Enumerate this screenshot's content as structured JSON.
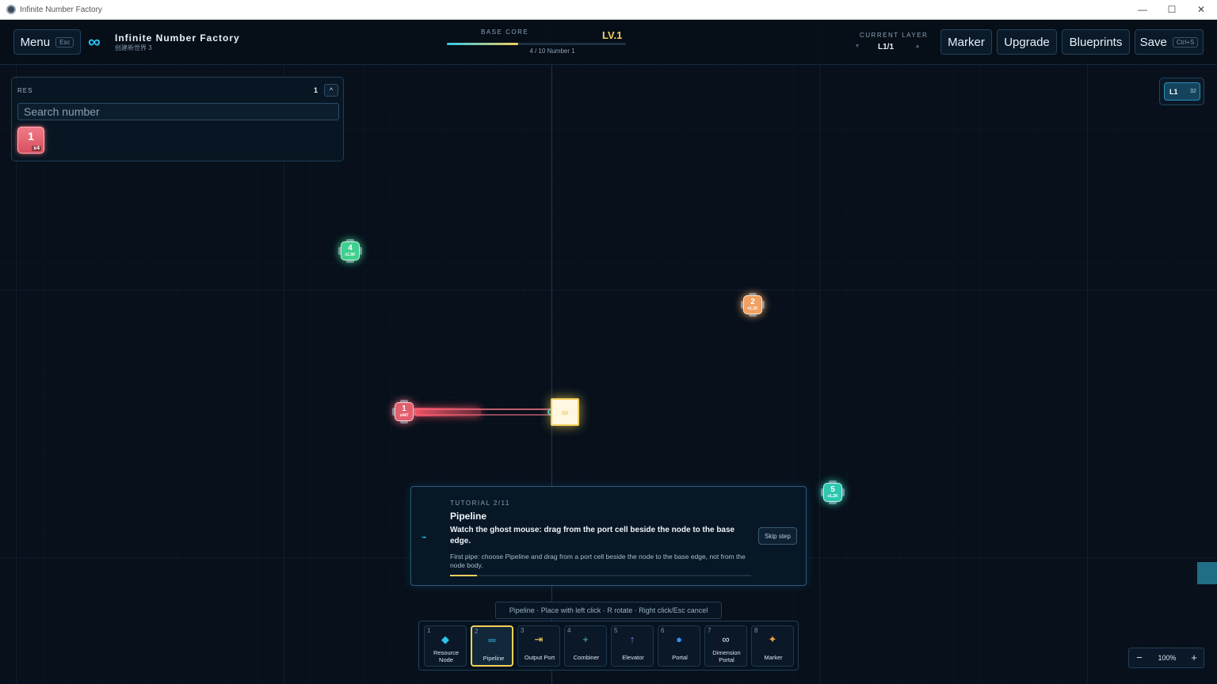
{
  "window": {
    "title": "Infinite Number Factory",
    "controls": {
      "minimize": "—",
      "maximize": "☐",
      "close": "✕"
    }
  },
  "header": {
    "menu_label": "Menu",
    "menu_key": "Esc",
    "logo_icon": "infinity-icon",
    "logo_glyph": "∞",
    "game_title": "Infinite Number Factory",
    "world_name": "创建新世界 3",
    "base_core": {
      "label": "BASE CORE",
      "level": "LV.1",
      "progress_text": "4 / 10 Number 1",
      "progress_fraction": 0.4
    },
    "current_layer": {
      "label": "CURRENT LAYER",
      "value": "L1/1",
      "down_arrow": "▼",
      "up_arrow": "▲"
    },
    "buttons": {
      "marker": "Marker",
      "upgrade": "Upgrade",
      "blueprints": "Blueprints",
      "save": "Save",
      "save_key": "Ctrl+S"
    }
  },
  "resources": {
    "title": "RES",
    "count": "1",
    "collapse_glyph": "^",
    "search_placeholder": "Search number",
    "items": [
      {
        "number": "1",
        "qty": "x4",
        "color": "#e0606e"
      }
    ]
  },
  "layer_badge": {
    "layer": "L1",
    "count": "32"
  },
  "map": {
    "nodes": [
      {
        "number": "4",
        "qty": "x1.5K",
        "color": "#3fcf8e"
      },
      {
        "number": "2",
        "qty": "x1.1K",
        "color": "#f0a060"
      },
      {
        "number": "1",
        "qty": "x447",
        "color": "#e0606e"
      },
      {
        "number": "5",
        "qty": "x1.2K",
        "color": "#2fc7b0"
      }
    ],
    "base_symbol": "∞"
  },
  "tutorial": {
    "icon_glyph": "⌁",
    "step": "TUTORIAL 2/11",
    "title": "Pipeline",
    "instruction": "Watch the ghost mouse: drag from the port cell beside the node to the base edge.",
    "description": "First pipe: choose Pipeline and drag from a port cell beside the node to the base edge, not from the node body.",
    "skip_label": "Skip step",
    "progress_fraction": 0.09
  },
  "tool_hint": "Pipeline · Place with left click · R rotate · Right click/Esc cancel",
  "toolbar": {
    "selected": "2",
    "tools": [
      {
        "key": "1",
        "label": "Resource Node",
        "icon": "diamond-icon",
        "glyph": "◆",
        "color": "#2ec3f0"
      },
      {
        "key": "2",
        "label": "Pipeline",
        "icon": "pipeline-icon",
        "glyph": "═",
        "color": "#2ec3f0"
      },
      {
        "key": "3",
        "label": "Output Port",
        "icon": "output-port-icon",
        "glyph": "⇥",
        "color": "#f2d15a"
      },
      {
        "key": "4",
        "label": "Combiner",
        "icon": "plus-icon",
        "glyph": "+",
        "color": "#3fcf8e"
      },
      {
        "key": "5",
        "label": "Elevator",
        "icon": "up-arrow-icon",
        "glyph": "↑",
        "color": "#a070f0"
      },
      {
        "key": "6",
        "label": "Portal",
        "icon": "portal-icon",
        "glyph": "●",
        "color": "#3a8cf0"
      },
      {
        "key": "7",
        "label": "Dimension Portal",
        "icon": "infinity-icon",
        "glyph": "∞",
        "color": "#d6e6f2"
      },
      {
        "key": "8",
        "label": "Marker",
        "icon": "marker-icon",
        "glyph": "✦",
        "color": "#f0a040"
      }
    ]
  },
  "zoom": {
    "value": "100%",
    "minus": "−",
    "plus": "+"
  }
}
